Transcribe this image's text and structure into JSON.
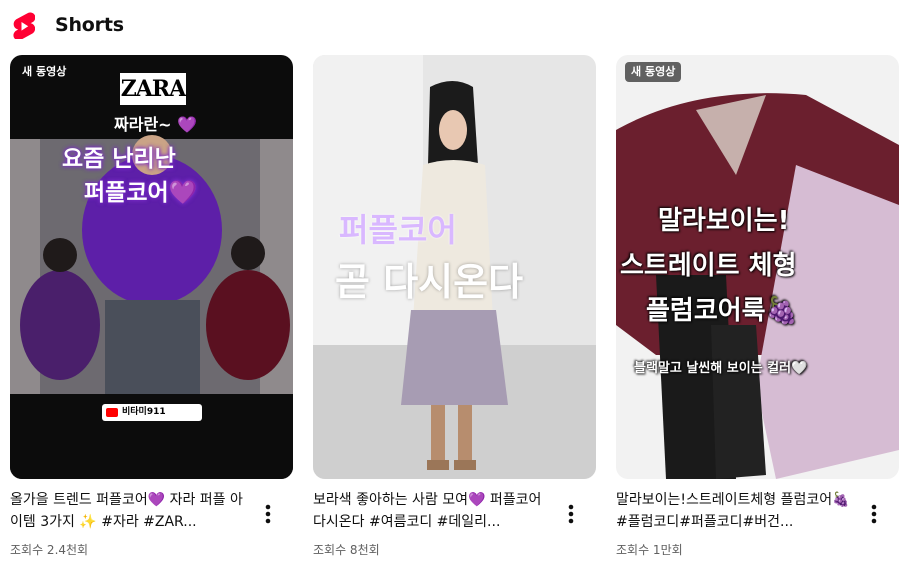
{
  "shelf": {
    "title": "Shorts",
    "logo_icon": "youtube-shorts-icon",
    "accent": "#ff0033"
  },
  "cards": [
    {
      "badge": "새 동영상",
      "overlay": {
        "brand": "ZARA",
        "line1": "짜라란~ 💜",
        "line2": "요즘 난리난",
        "line3": "퍼플코어💜",
        "channel_tag": "비타미911"
      },
      "title": "올가을 트렌드 퍼플코어💜 자라 퍼플 아이템 3가지 ✨ #자라 #ZAR...",
      "views": "조회수 2.4천회",
      "menu_icon": "more-vert-icon"
    },
    {
      "badge": "",
      "overlay": {
        "line1": "퍼플코어",
        "line2": "곧 다시온다"
      },
      "title": "보라색 좋아하는 사람 모여💜 퍼플코어 다시온다 #여름코디 #데일리...",
      "views": "조회수 8천회",
      "menu_icon": "more-vert-icon"
    },
    {
      "badge": "새 동영상",
      "overlay": {
        "line1": "말라보이는!",
        "line2": "스트레이트 체형",
        "line3": "플럼코어룩🍇",
        "line4": "블랙말고 날씬해 보이는 컬러🤍"
      },
      "title": "말라보이는!스트레이트체형 플럼코어🍇 #플럼코디#퍼플코디#버건...",
      "views": "조회수 1만회",
      "menu_icon": "more-vert-icon"
    }
  ]
}
